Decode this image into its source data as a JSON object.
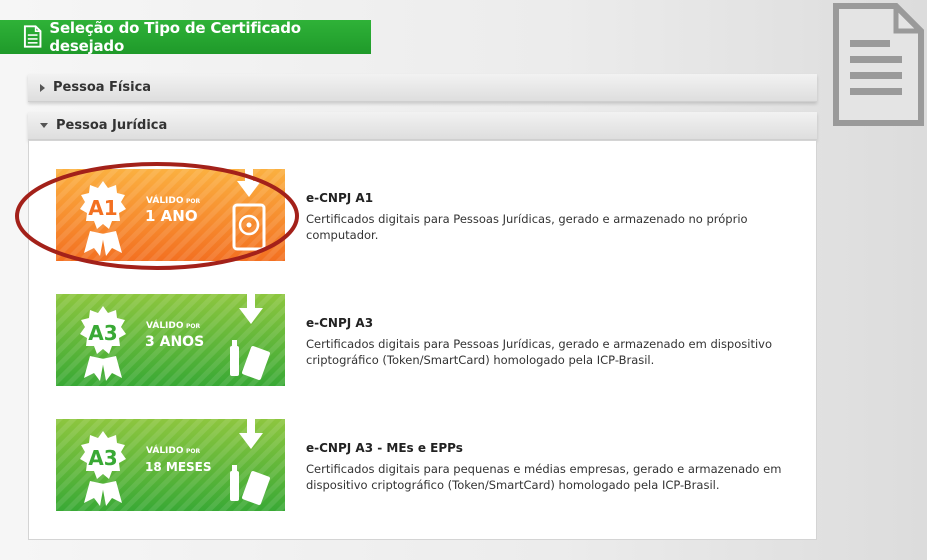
{
  "header": {
    "title": "Seleção do Tipo de Certificado desejado"
  },
  "sections": [
    {
      "label": "Pessoa Física",
      "expanded": false
    },
    {
      "label": "Pessoa Jurídica",
      "expanded": true
    }
  ],
  "certificates": [
    {
      "badge": "A1",
      "valid_label": "VÁLIDO",
      "valid_por": "POR",
      "duration": "1 ANO",
      "color": "#f7941d",
      "title": "e-CNPJ A1",
      "description": "Certificados digitais para Pessoas Jurídicas, gerado e armazenado no próprio computador.",
      "highlighted": true
    },
    {
      "badge": "A3",
      "valid_label": "VÁLIDO",
      "valid_por": "POR",
      "duration": "3 ANOS",
      "color": "#5cb82e",
      "title": "e-CNPJ A3",
      "description": "Certificados digitais para Pessoas Jurídicas, gerado e armazenado em dispositivo criptográfico (Token/SmartCard) homologado pela ICP-Brasil.",
      "highlighted": false
    },
    {
      "badge": "A3",
      "valid_label": "VÁLIDO",
      "valid_por": "POR",
      "duration": "18 MESES",
      "color": "#5cb82e",
      "title": "e-CNPJ A3 - MEs e EPPs",
      "description": "Certificados digitais para pequenas e médias empresas, gerado e armazenado em dispositivo criptográfico (Token/SmartCard) homologado pela ICP-Brasil.",
      "highlighted": false
    }
  ],
  "colors": {
    "header_green": "#23a52f",
    "highlight_ring": "#a3211a"
  }
}
